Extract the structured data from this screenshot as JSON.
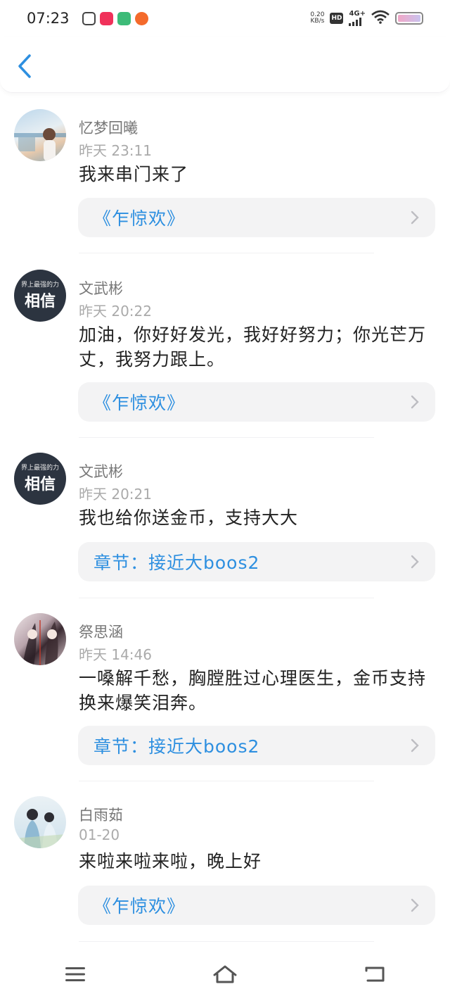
{
  "status_bar": {
    "time": "07:23",
    "speed_value": "0.20",
    "speed_unit": "KB/s",
    "hd": "HD",
    "network": "4G+"
  },
  "comments": [
    {
      "username": "忆梦回曦",
      "time": "昨天 23:11",
      "content": "我来串门来了",
      "work": "《乍惊欢》",
      "avatar_colors": [
        "#c9ddec",
        "#e8d3bf"
      ]
    },
    {
      "username": "文武彬",
      "time": "昨天 20:22",
      "content": "加油，你好好发光，我好好努力；你光芒万丈，我努力跟上。",
      "work": "《乍惊欢》",
      "avatar_text_top": "界上最强的力",
      "avatar_text_main": "相信"
    },
    {
      "username": "文武彬",
      "time": "昨天 20:21",
      "content": "我也给你送金币，支持大大",
      "work": "章节：接近大boos2",
      "avatar_text_top": "界上最强的力",
      "avatar_text_main": "相信"
    },
    {
      "username": "祭思涵",
      "time": "昨天 14:46",
      "content": "一嗓解千愁，胸膛胜过心理医生，金币支持换来爆笑泪奔。",
      "work": "章节：接近大boos2",
      "avatar_colors": [
        "#6b4a55",
        "#e9dde0"
      ]
    },
    {
      "username": "白雨茹",
      "time": "01-20",
      "content": "来啦来啦来啦，晚上好",
      "work": "《乍惊欢》",
      "avatar_colors": [
        "#dfeaf2",
        "#b9d7e6"
      ]
    }
  ],
  "colors": {
    "link": "#2d8fe0",
    "card_bg": "#f3f3f4",
    "back_arrow": "#2d8fe0"
  }
}
